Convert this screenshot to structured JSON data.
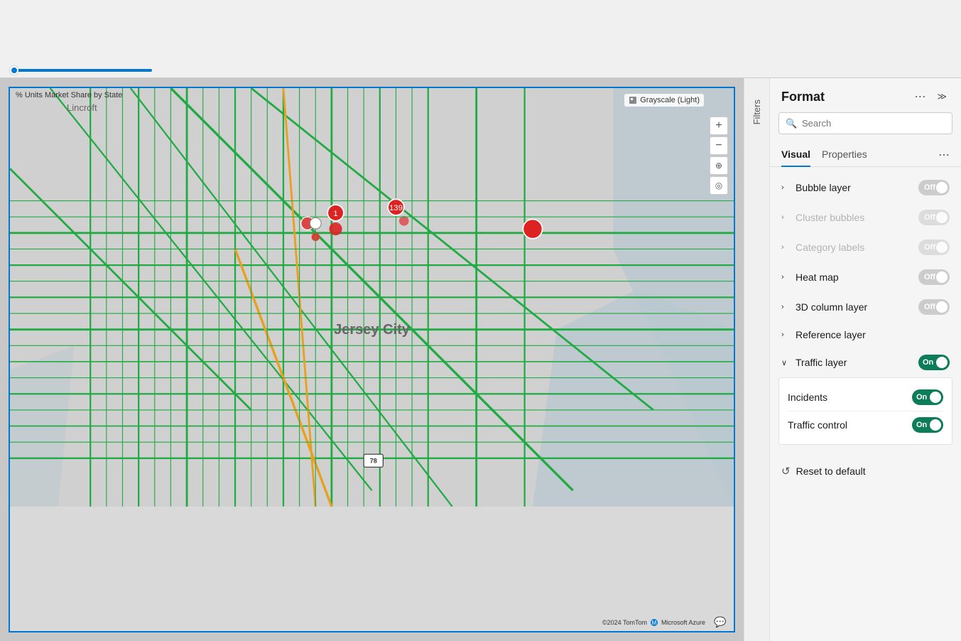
{
  "topArea": {
    "sliderValue": 0
  },
  "mapArea": {
    "title": "% Units Market Share by State",
    "styleBadge": "Grayscale (Light)",
    "attribution": "©2024 TomTom",
    "msAzure": "Microsoft Azure",
    "jerseyCity": "Jersey City",
    "lincroft": "Lincroft"
  },
  "filtersSidebar": {
    "label": "Filters"
  },
  "formatPanel": {
    "title": "Format",
    "searchPlaceholder": "Search",
    "tabs": [
      {
        "label": "Visual",
        "active": true
      },
      {
        "label": "Properties",
        "active": false
      }
    ],
    "layers": [
      {
        "key": "bubble-layer",
        "name": "Bubble layer",
        "state": "off",
        "disabled": false,
        "expanded": false
      },
      {
        "key": "cluster-bubbles",
        "name": "Cluster bubbles",
        "state": "off",
        "disabled": true,
        "expanded": false
      },
      {
        "key": "category-labels",
        "name": "Category labels",
        "state": "off",
        "disabled": true,
        "expanded": false
      },
      {
        "key": "heat-map",
        "name": "Heat map",
        "state": "off",
        "disabled": false,
        "expanded": false
      },
      {
        "key": "3d-column-layer",
        "name": "3D column layer",
        "state": "off",
        "disabled": false,
        "expanded": false
      },
      {
        "key": "reference-layer",
        "name": "Reference layer",
        "state": "none",
        "disabled": false,
        "expanded": false
      },
      {
        "key": "traffic-layer",
        "name": "Traffic layer",
        "state": "on",
        "disabled": false,
        "expanded": true
      }
    ],
    "trafficSubItems": [
      {
        "key": "incidents",
        "label": "Incidents",
        "state": "on"
      },
      {
        "key": "traffic-control",
        "label": "Traffic control",
        "state": "on"
      }
    ],
    "resetLabel": "Reset to default",
    "moreActions": "...",
    "backLabel": "<<",
    "forwardLabel": ">>"
  },
  "toolbar": {
    "filterIcon": "⊿",
    "expandIcon": "⤢",
    "moreIcon": "⋯"
  }
}
